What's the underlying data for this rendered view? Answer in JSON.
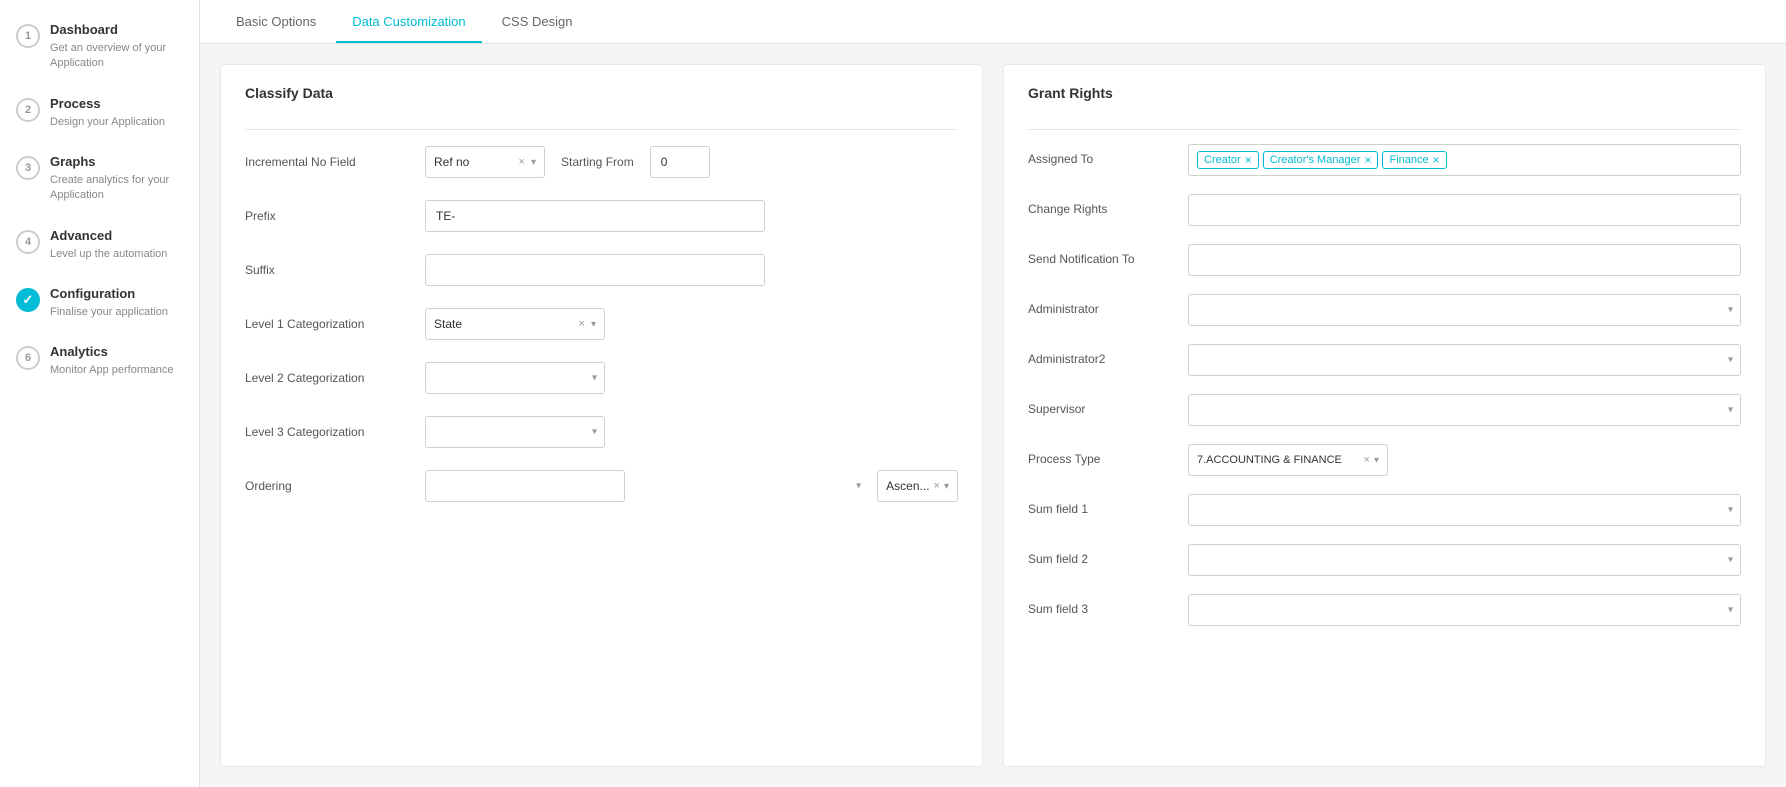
{
  "sidebar": {
    "items": [
      {
        "num": "1",
        "type": "normal",
        "title": "Dashboard",
        "sub": "Get an overview of your Application"
      },
      {
        "num": "2",
        "type": "normal",
        "title": "Process",
        "sub": "Design your Application"
      },
      {
        "num": "3",
        "type": "normal",
        "title": "Graphs",
        "sub": "Create analytics for your Application"
      },
      {
        "num": "4",
        "type": "normal",
        "title": "Advanced",
        "sub": "Level up the automation"
      },
      {
        "num": "5",
        "type": "check",
        "title": "Configuration",
        "sub": "Finalise your application"
      },
      {
        "num": "6",
        "type": "normal",
        "title": "Analytics",
        "sub": "Monitor App performance"
      }
    ]
  },
  "tabs": [
    {
      "label": "Basic Options",
      "active": false
    },
    {
      "label": "Data Customization",
      "active": true
    },
    {
      "label": "CSS Design",
      "active": false
    }
  ],
  "classify": {
    "title": "Classify Data",
    "incremental_label": "Incremental No Field",
    "incremental_value": "Ref no",
    "starting_from_label": "Starting From",
    "starting_from_value": "0",
    "prefix_label": "Prefix",
    "prefix_value": "TE-",
    "suffix_label": "Suffix",
    "suffix_value": "",
    "level1_label": "Level 1 Categorization",
    "level1_value": "State",
    "level2_label": "Level 2 Categorization",
    "level2_value": "",
    "level3_label": "Level 3 Categorization",
    "level3_value": "",
    "ordering_label": "Ordering",
    "ordering_value": "",
    "ordering_dir": "Ascen..."
  },
  "grant": {
    "title": "Grant Rights",
    "assigned_to_label": "Assigned To",
    "assigned_chips": [
      "Creator",
      "Creator's Manager",
      "Finance"
    ],
    "change_rights_label": "Change Rights",
    "send_notification_label": "Send Notification To",
    "administrator_label": "Administrator",
    "administrator2_label": "Administrator2",
    "supervisor_label": "Supervisor",
    "process_type_label": "Process Type",
    "process_type_value": "7.ACCOUNTING & FINANCE",
    "sum_field1_label": "Sum field 1",
    "sum_field2_label": "Sum field 2",
    "sum_field3_label": "Sum field 3"
  }
}
